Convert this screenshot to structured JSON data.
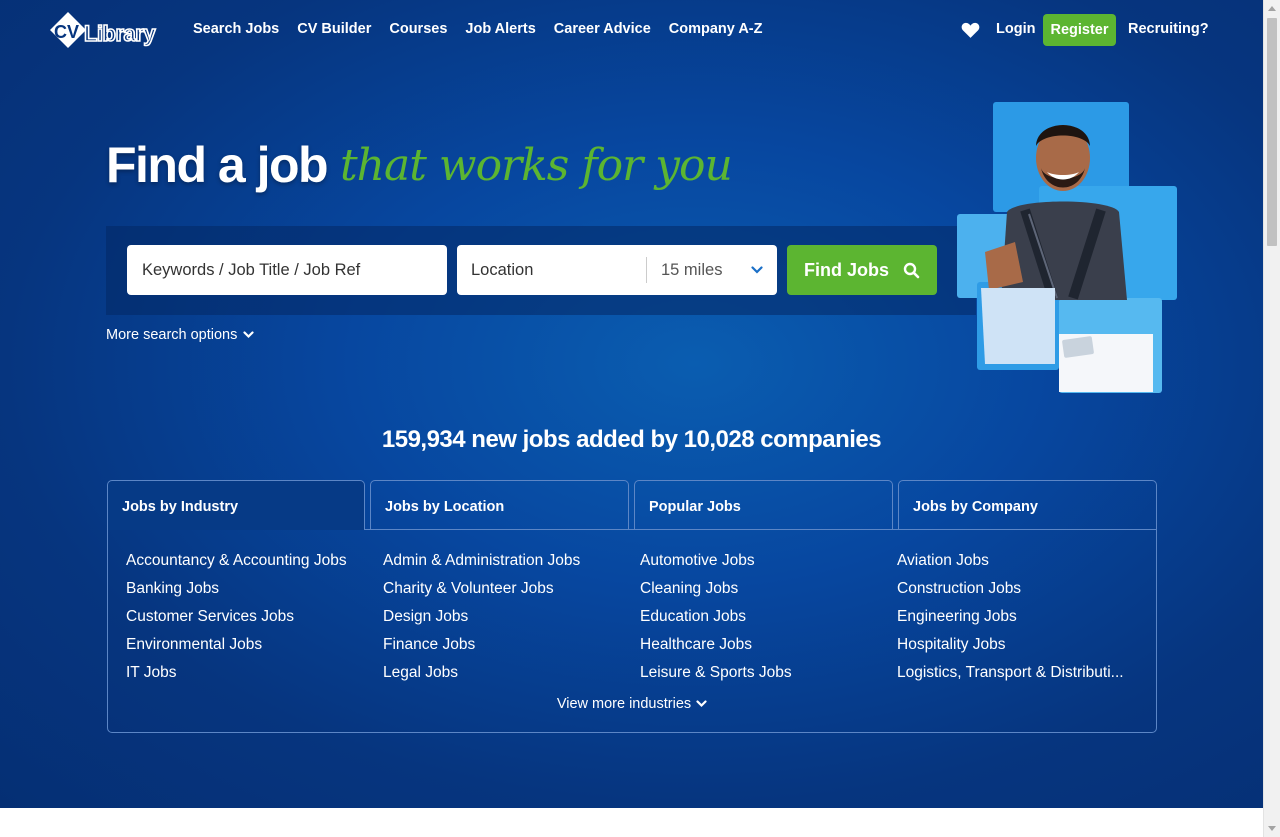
{
  "header": {
    "logo_text": "CV Library",
    "nav": [
      "Search Jobs",
      "CV Builder",
      "Courses",
      "Job Alerts",
      "Career Advice",
      "Company A-Z"
    ],
    "login": "Login",
    "register": "Register",
    "recruiting": "Recruiting?"
  },
  "hero": {
    "headline": "Find a job",
    "tagline": "that works for you"
  },
  "search": {
    "keywords_placeholder": "Keywords / Job Title / Job Ref",
    "location_placeholder": "Location",
    "radius": "15 miles",
    "find_button": "Find Jobs",
    "more_options": "More search options"
  },
  "stats": "159,934 new jobs added by 10,028 companies",
  "tabs": [
    "Jobs by Industry",
    "Jobs by Location",
    "Popular Jobs",
    "Jobs by Company"
  ],
  "industries": {
    "col1": [
      "Accountancy & Accounting Jobs",
      "Banking Jobs",
      "Customer Services Jobs",
      "Environmental Jobs",
      "IT Jobs"
    ],
    "col2": [
      "Admin & Administration Jobs",
      "Charity & Volunteer Jobs",
      "Design Jobs",
      "Finance Jobs",
      "Legal Jobs"
    ],
    "col3": [
      "Automotive Jobs",
      "Cleaning Jobs",
      "Education Jobs",
      "Healthcare Jobs",
      "Leisure & Sports Jobs"
    ],
    "col4": [
      "Aviation Jobs",
      "Construction Jobs",
      "Engineering Jobs",
      "Hospitality Jobs",
      "Logistics, Transport & Distributi..."
    ]
  },
  "view_more": "View more industries",
  "colors": {
    "brand_blue": "#06357f",
    "accent_green": "#5cb531"
  }
}
